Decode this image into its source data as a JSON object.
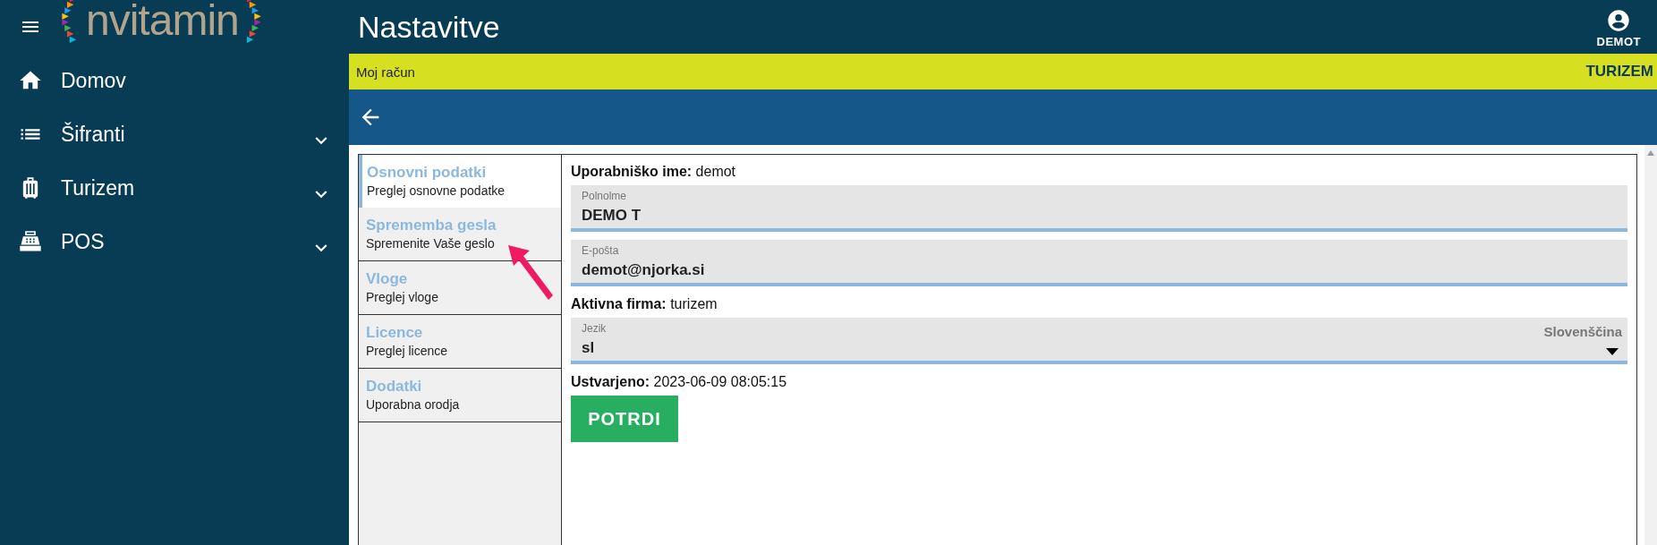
{
  "header": {
    "logo": "nvitamin",
    "title": "Nastavitve",
    "user": "DEMOT"
  },
  "sidebar": {
    "items": [
      {
        "label": "Domov",
        "kind": "home",
        "expandable": false
      },
      {
        "label": "Šifranti",
        "kind": "list",
        "expandable": true
      },
      {
        "label": "Turizem",
        "kind": "luggage",
        "expandable": true
      },
      {
        "label": "POS",
        "kind": "register",
        "expandable": true
      }
    ]
  },
  "breadcrumb": {
    "text": "Moj račun",
    "company": "TURIZEM"
  },
  "tabs": [
    {
      "title": "Osnovni podatki",
      "subtitle": "Preglej osnovne podatke",
      "selected": true
    },
    {
      "title": "Sprememba gesla",
      "subtitle": "Spremenite Vaše geslo",
      "selected": false
    },
    {
      "title": "Vloge",
      "subtitle": "Preglej vloge",
      "selected": false
    },
    {
      "title": "Licence",
      "subtitle": "Preglej licence",
      "selected": false
    },
    {
      "title": "Dodatki",
      "subtitle": "Uporabna orodja",
      "selected": false
    }
  ],
  "form": {
    "rows": [
      {
        "kind": "info",
        "text": "**Uporabniško ime:** demot"
      },
      {
        "kind": "field",
        "label": "Polnolme",
        "value": "DEMO T"
      },
      {
        "kind": "field",
        "label": "E-pošta",
        "value": "demot@njorka.si"
      },
      {
        "kind": "info",
        "text": "**Aktivna firma:** turizem"
      },
      {
        "kind": "select",
        "label": "Jezik",
        "value": "sl",
        "option_text": "Slovenščina"
      },
      {
        "kind": "info",
        "text": "**Ustvarjeno:** 2023-06-09 08:05:15"
      }
    ],
    "button": "POTRDI"
  }
}
